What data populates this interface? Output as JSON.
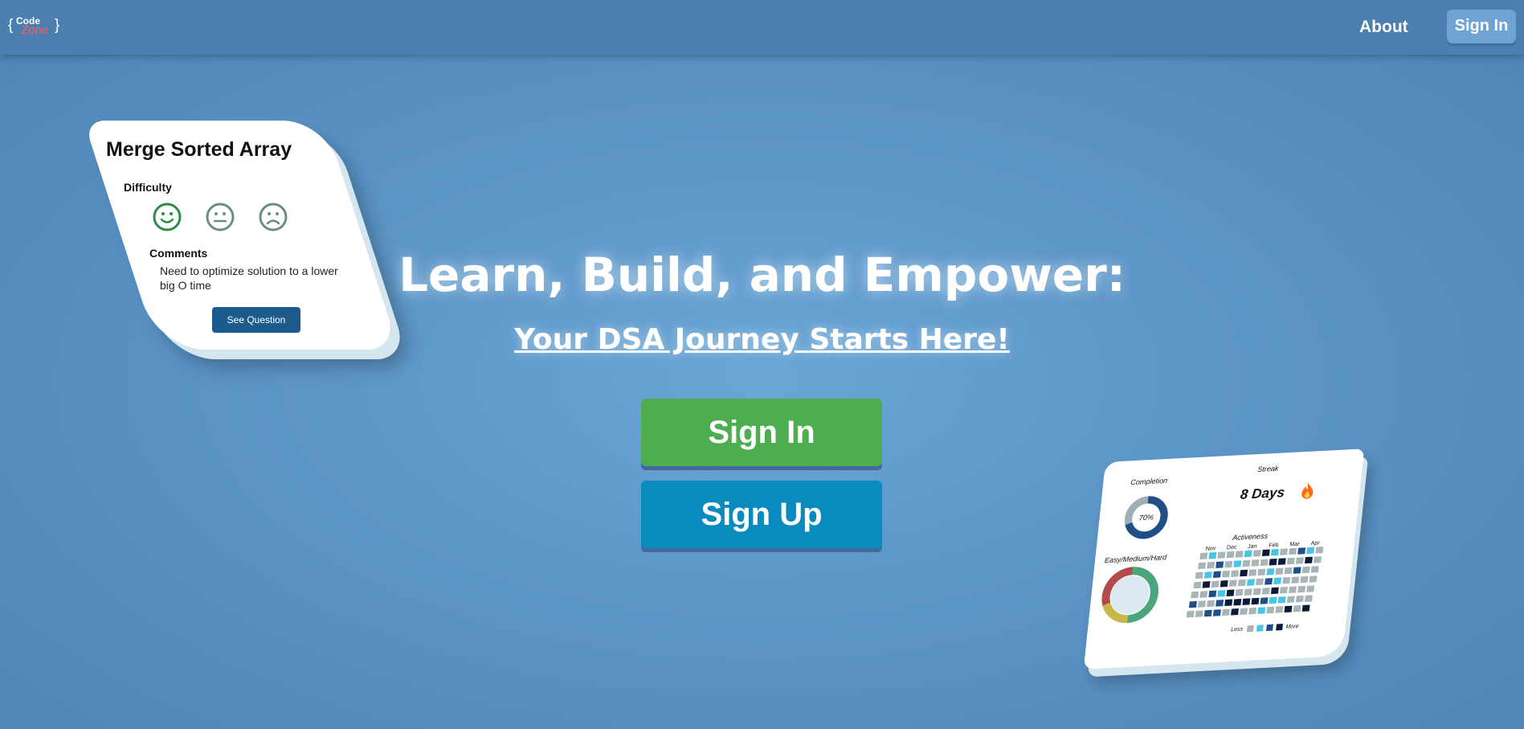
{
  "logo": {
    "code": "Code",
    "zone": "Zone",
    "open_brace": "{",
    "close_brace": "}"
  },
  "nav": {
    "about_label": "About",
    "signin_label": "Sign In"
  },
  "hero": {
    "title": "Learn, Build, and Empower:",
    "subtitle": "Your DSA Journey Starts Here!",
    "signin_label": "Sign In",
    "signup_label": "Sign Up"
  },
  "card_left": {
    "title": "Merge Sorted Array",
    "difficulty_label": "Difficulty",
    "faces": [
      "happy-face-icon",
      "neutral-face-icon",
      "sad-face-icon"
    ],
    "selected_face": "happy-face-icon",
    "comments_label": "Comments",
    "comment_text": "Need to optimize solution to a lower big O time",
    "button_label": "See Question"
  },
  "card_right": {
    "completion_label": "Completion",
    "completion_value": "70%",
    "completion_fraction": 0.7,
    "streak_label": "Streak",
    "streak_value": "8 Days",
    "streak_icon": "fire-icon",
    "difficulty_label": "Easy/Medium/Hard",
    "activeness_label": "Activeness",
    "months": [
      "Nov",
      "Dec",
      "Jan",
      "Feb",
      "Mar",
      "Apr"
    ],
    "legend_less": "Less",
    "legend_more": "More"
  },
  "colors": {
    "signin_green": "#4cae4f",
    "signup_blue": "#0a8bc0",
    "nav_bg": "#4b7fb0",
    "logo_zone": "#ff5c5c",
    "button_dark": "#1d5b8e"
  }
}
